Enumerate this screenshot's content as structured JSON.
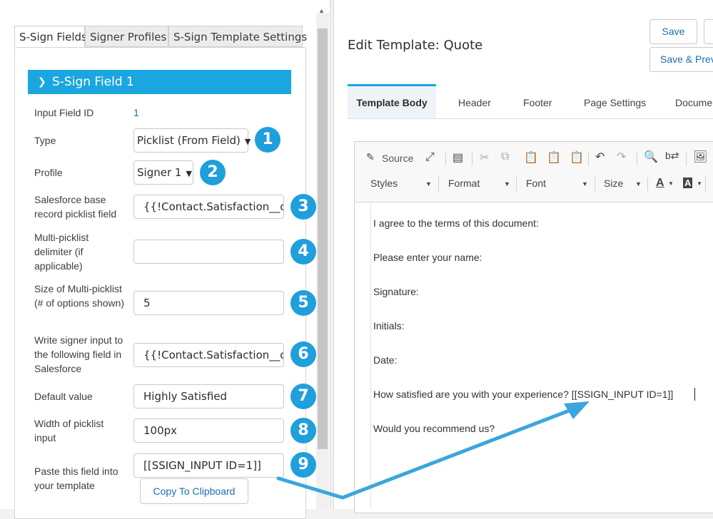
{
  "left_panel": {
    "tabs": [
      "S-Sign Fields",
      "Signer Profiles",
      "S-Sign Template Settings"
    ],
    "section_title": "S-Sign Field 1",
    "fields": {
      "input_field_id": {
        "label": "Input Field ID",
        "value": "1"
      },
      "type": {
        "label": "Type",
        "value": "Picklist (From Field)"
      },
      "profile": {
        "label": "Profile",
        "value": "Signer 1"
      },
      "base_field": {
        "label": "Salesforce base record picklist field",
        "value": "{{!Contact.Satisfaction__c}"
      },
      "delimiter": {
        "label": "Multi-picklist delimiter (if applicable)",
        "value": ""
      },
      "size": {
        "label": "Size of Multi-picklist (# of options shown)",
        "value": "5"
      },
      "write_to": {
        "label": "Write signer input to the following field in Salesforce",
        "value": "{{!Contact.Satisfaction__c}"
      },
      "default": {
        "label": "Default value",
        "value": "Highly Satisfied"
      },
      "width": {
        "label": "Width of picklist input",
        "value": "100px"
      },
      "paste": {
        "label": "Paste this field into your template",
        "value": "[[SSIGN_INPUT ID=1]]"
      }
    },
    "copy_button": "Copy To Clipboard",
    "badges": [
      "1",
      "2",
      "3",
      "4",
      "5",
      "6",
      "7",
      "8",
      "9"
    ]
  },
  "right_panel": {
    "title": "Edit Template: Quote",
    "buttons": {
      "save": "Save",
      "save_preview": "Save & Prev"
    },
    "tabs": [
      "Template Body",
      "Header",
      "Footer",
      "Page Settings",
      "Docume"
    ],
    "toolbar": {
      "source": "Source",
      "dropdowns": [
        "Styles",
        "Format",
        "Font",
        "Size"
      ]
    },
    "document_lines": [
      "I agree to the terms of this document:",
      "Please enter your name:",
      "Signature:",
      "Initials:",
      "Date:",
      "How satisfied are you with your experience? [[SSIGN_INPUT ID=1]]",
      "Would you recommend us?"
    ]
  },
  "colors": {
    "accent": "#1ba6e0",
    "badge": "#1f9fdb",
    "link": "#1a6fb0",
    "arrow": "#3aa6dc"
  }
}
